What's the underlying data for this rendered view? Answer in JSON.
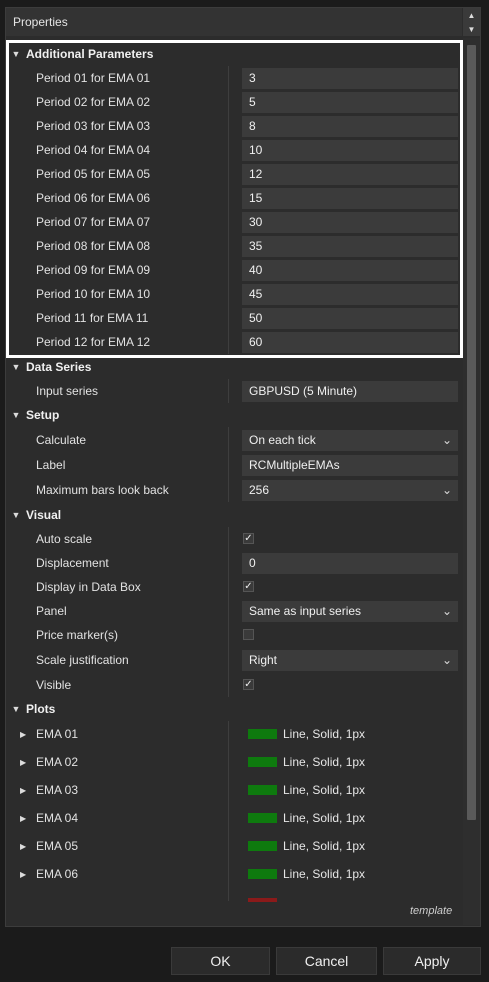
{
  "window": {
    "title": "Properties"
  },
  "categories": {
    "additional": "Additional Parameters",
    "data_series": "Data Series",
    "setup": "Setup",
    "visual": "Visual",
    "plots": "Plots"
  },
  "periods": [
    {
      "label": "Period 01 for EMA 01",
      "value": "3"
    },
    {
      "label": "Period 02 for EMA 02",
      "value": "5"
    },
    {
      "label": "Period 03 for EMA 03",
      "value": "8"
    },
    {
      "label": "Period 04 for EMA 04",
      "value": "10"
    },
    {
      "label": "Period 05 for EMA 05",
      "value": "12"
    },
    {
      "label": "Period 06 for EMA 06",
      "value": "15"
    },
    {
      "label": "Period 07 for EMA 07",
      "value": "30"
    },
    {
      "label": "Period 08 for EMA 08",
      "value": "35"
    },
    {
      "label": "Period 09 for EMA 09",
      "value": "40"
    },
    {
      "label": "Period 10 for EMA 10",
      "value": "45"
    },
    {
      "label": "Period 11 for EMA 11",
      "value": "50"
    },
    {
      "label": "Period 12 for EMA 12",
      "value": "60"
    }
  ],
  "data_series": {
    "input_label": "Input series",
    "input_value": "GBPUSD (5 Minute)"
  },
  "setup": {
    "calculate_label": "Calculate",
    "calculate_value": "On each tick",
    "label_label": "Label",
    "label_value": "RCMultipleEMAs",
    "maxbars_label": "Maximum bars look back",
    "maxbars_value": "256"
  },
  "visual": {
    "autoscale_label": "Auto scale",
    "displacement_label": "Displacement",
    "displacement_value": "0",
    "databox_label": "Display in Data Box",
    "panel_label": "Panel",
    "panel_value": "Same as input series",
    "pricemarker_label": "Price marker(s)",
    "scalejust_label": "Scale justification",
    "scalejust_value": "Right",
    "visible_label": "Visible"
  },
  "plots": [
    {
      "label": "EMA 01",
      "value": "Line, Solid, 1px"
    },
    {
      "label": "EMA 02",
      "value": "Line, Solid, 1px"
    },
    {
      "label": "EMA 03",
      "value": "Line, Solid, 1px"
    },
    {
      "label": "EMA 04",
      "value": "Line, Solid, 1px"
    },
    {
      "label": "EMA 05",
      "value": "Line, Solid, 1px"
    },
    {
      "label": "EMA 06",
      "value": "Line, Solid, 1px"
    }
  ],
  "colors": {
    "plot_green": "#0e7a0e",
    "highlight": "#ffffff"
  },
  "footer": {
    "template": "template",
    "ok": "OK",
    "cancel": "Cancel",
    "apply": "Apply"
  }
}
